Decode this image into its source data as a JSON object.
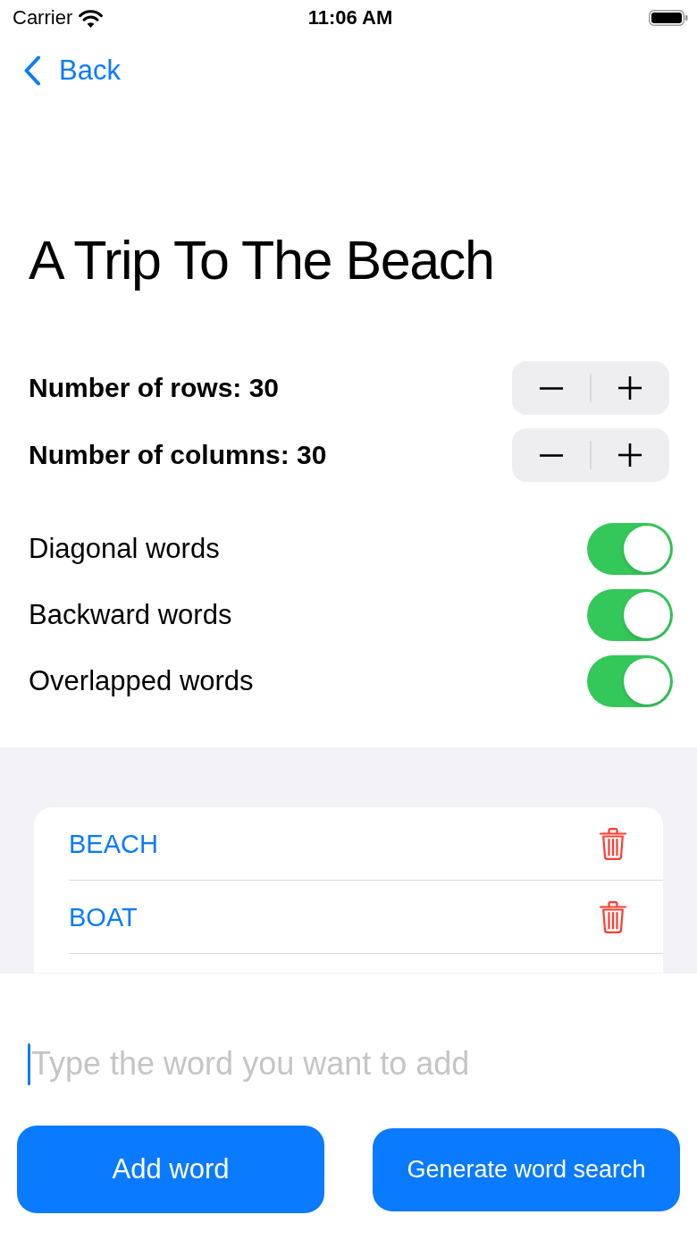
{
  "status_bar": {
    "carrier": "Carrier",
    "time": "11:06 AM"
  },
  "navigation": {
    "back_label": "Back"
  },
  "title": "A Trip To The Beach",
  "steppers": [
    {
      "label": "Number of rows: 30"
    },
    {
      "label": "Number of columns: 30"
    }
  ],
  "toggles": [
    {
      "label": "Diagonal words",
      "on": true
    },
    {
      "label": "Backward words",
      "on": true
    },
    {
      "label": "Overlapped words",
      "on": true
    }
  ],
  "word_list": [
    {
      "word": "BEACH"
    },
    {
      "word": "BOAT"
    }
  ],
  "word_input": {
    "placeholder": "Type the word you want to add"
  },
  "buttons": [
    {
      "label": "Add word"
    },
    {
      "label": "Generate word search"
    }
  ]
}
